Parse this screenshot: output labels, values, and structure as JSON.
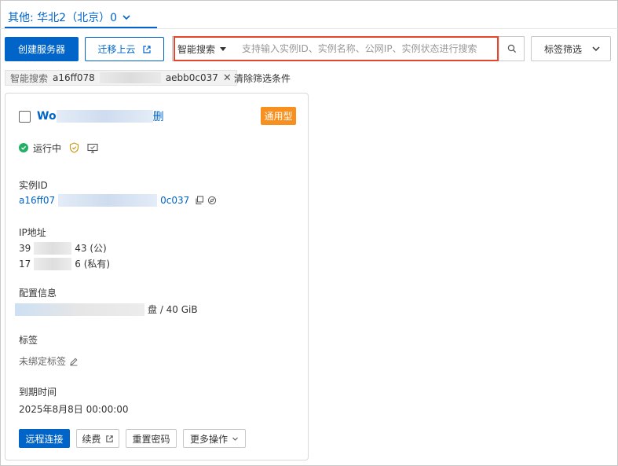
{
  "region_tab": {
    "label": "其他: 华北2（北京）0"
  },
  "toolbar": {
    "create_label": "创建服务器",
    "migrate_label": "迁移上云",
    "tag_filter_label": "标签筛选"
  },
  "search": {
    "mode_label": "智能搜索",
    "placeholder": "支持输入实例ID、实例名称、公网IP、实例状态进行搜索"
  },
  "filter_chip": {
    "key": "智能搜索",
    "value_prefix": "a16ff078",
    "value_suffix": "aebb0c037"
  },
  "clear_filters_label": "清除筛选条件",
  "card": {
    "name_prefix": "Wo",
    "name_suffix": "删",
    "type_badge": "通用型",
    "status_label": "运行中",
    "instance_id_label": "实例ID",
    "instance_id_prefix": "a16ff07",
    "instance_id_suffix": "0c037",
    "ip_label": "IP地址",
    "ip_public_prefix": "39",
    "ip_public_suffix": "43 (公)",
    "ip_private_prefix": "17",
    "ip_private_suffix": "6 (私有)",
    "config_label": "配置信息",
    "config_suffix": "盘 / 40 GiB",
    "tags_label": "标签",
    "tags_value": "未绑定标签",
    "expire_label": "到期时间",
    "expire_value": "2025年8月8日 00:00:00",
    "btn_remote": "远程连接",
    "btn_renew": "续费",
    "btn_reset": "重置密码",
    "btn_more": "更多操作"
  },
  "colors": {
    "brand_blue": "#0064c8",
    "highlight_red": "#e4452b",
    "badge_orange": "#f7901e",
    "status_green": "#23b066"
  }
}
